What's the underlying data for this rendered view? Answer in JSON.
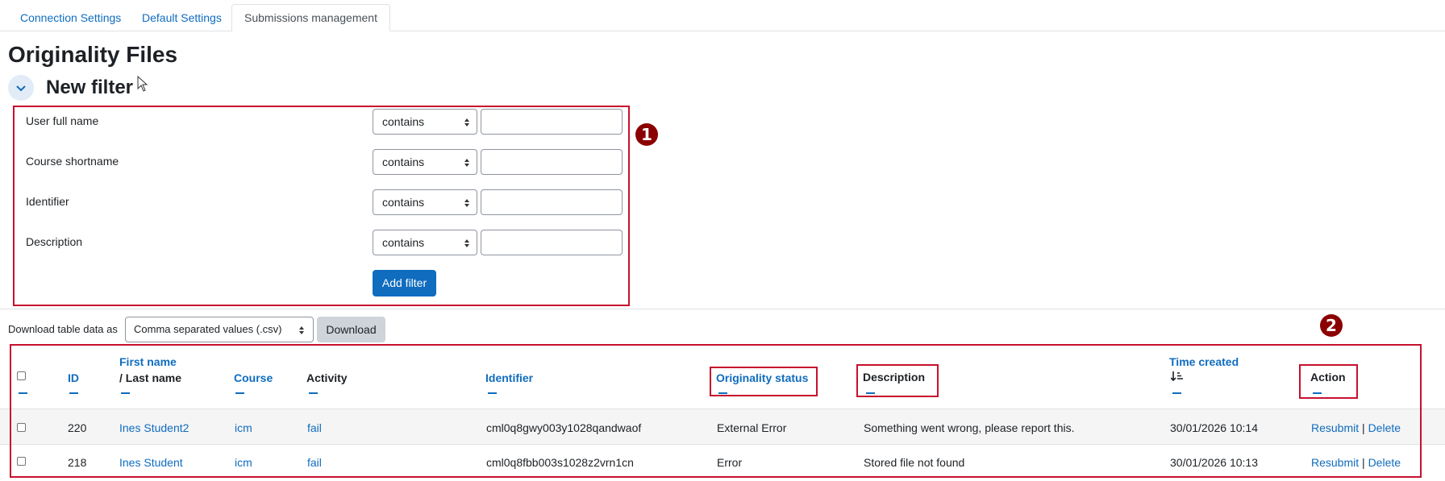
{
  "tabs": [
    {
      "label": "Connection Settings"
    },
    {
      "label": "Default Settings"
    },
    {
      "label": "Submissions management"
    }
  ],
  "page_title": "Originality Files",
  "filter": {
    "heading": "New filter",
    "rows": [
      {
        "label": "User full name",
        "operator": "contains",
        "value": ""
      },
      {
        "label": "Course shortname",
        "operator": "contains",
        "value": ""
      },
      {
        "label": "Identifier",
        "operator": "contains",
        "value": ""
      },
      {
        "label": "Description",
        "operator": "contains",
        "value": ""
      }
    ],
    "add_button": "Add filter"
  },
  "markers": [
    "1",
    "2"
  ],
  "download": {
    "label": "Download table data as",
    "format": "Comma separated values (.csv)",
    "button": "Download"
  },
  "table": {
    "headers": {
      "id": "ID",
      "first_name": "First name",
      "last_name": "/ Last name",
      "course": "Course",
      "activity": "Activity",
      "identifier": "Identifier",
      "originality_status": "Originality status",
      "description": "Description",
      "time_created": "Time created",
      "action": "Action"
    },
    "rows": [
      {
        "id": "220",
        "name": "Ines Student2",
        "course": "icm",
        "activity": "fail",
        "identifier": "cml0q8gwy003y1028qandwaof",
        "status": "External Error",
        "description": "Something went wrong, please report this.",
        "time": "30/01/2026 10:14",
        "resubmit": "Resubmit",
        "sep": "|",
        "delete": "Delete"
      },
      {
        "id": "218",
        "name": "Ines Student",
        "course": "icm",
        "activity": "fail",
        "identifier": "cml0q8fbb003s1028z2vrn1cn",
        "status": "Error",
        "description": "Stored file not found",
        "time": "30/01/2026 10:13",
        "resubmit": "Resubmit",
        "sep": "|",
        "delete": "Delete"
      }
    ]
  },
  "colors": {
    "link": "#0f6cbf",
    "primary": "#0f6cbf",
    "highlight_border": "#c8102e",
    "marker": "#8b0000"
  }
}
